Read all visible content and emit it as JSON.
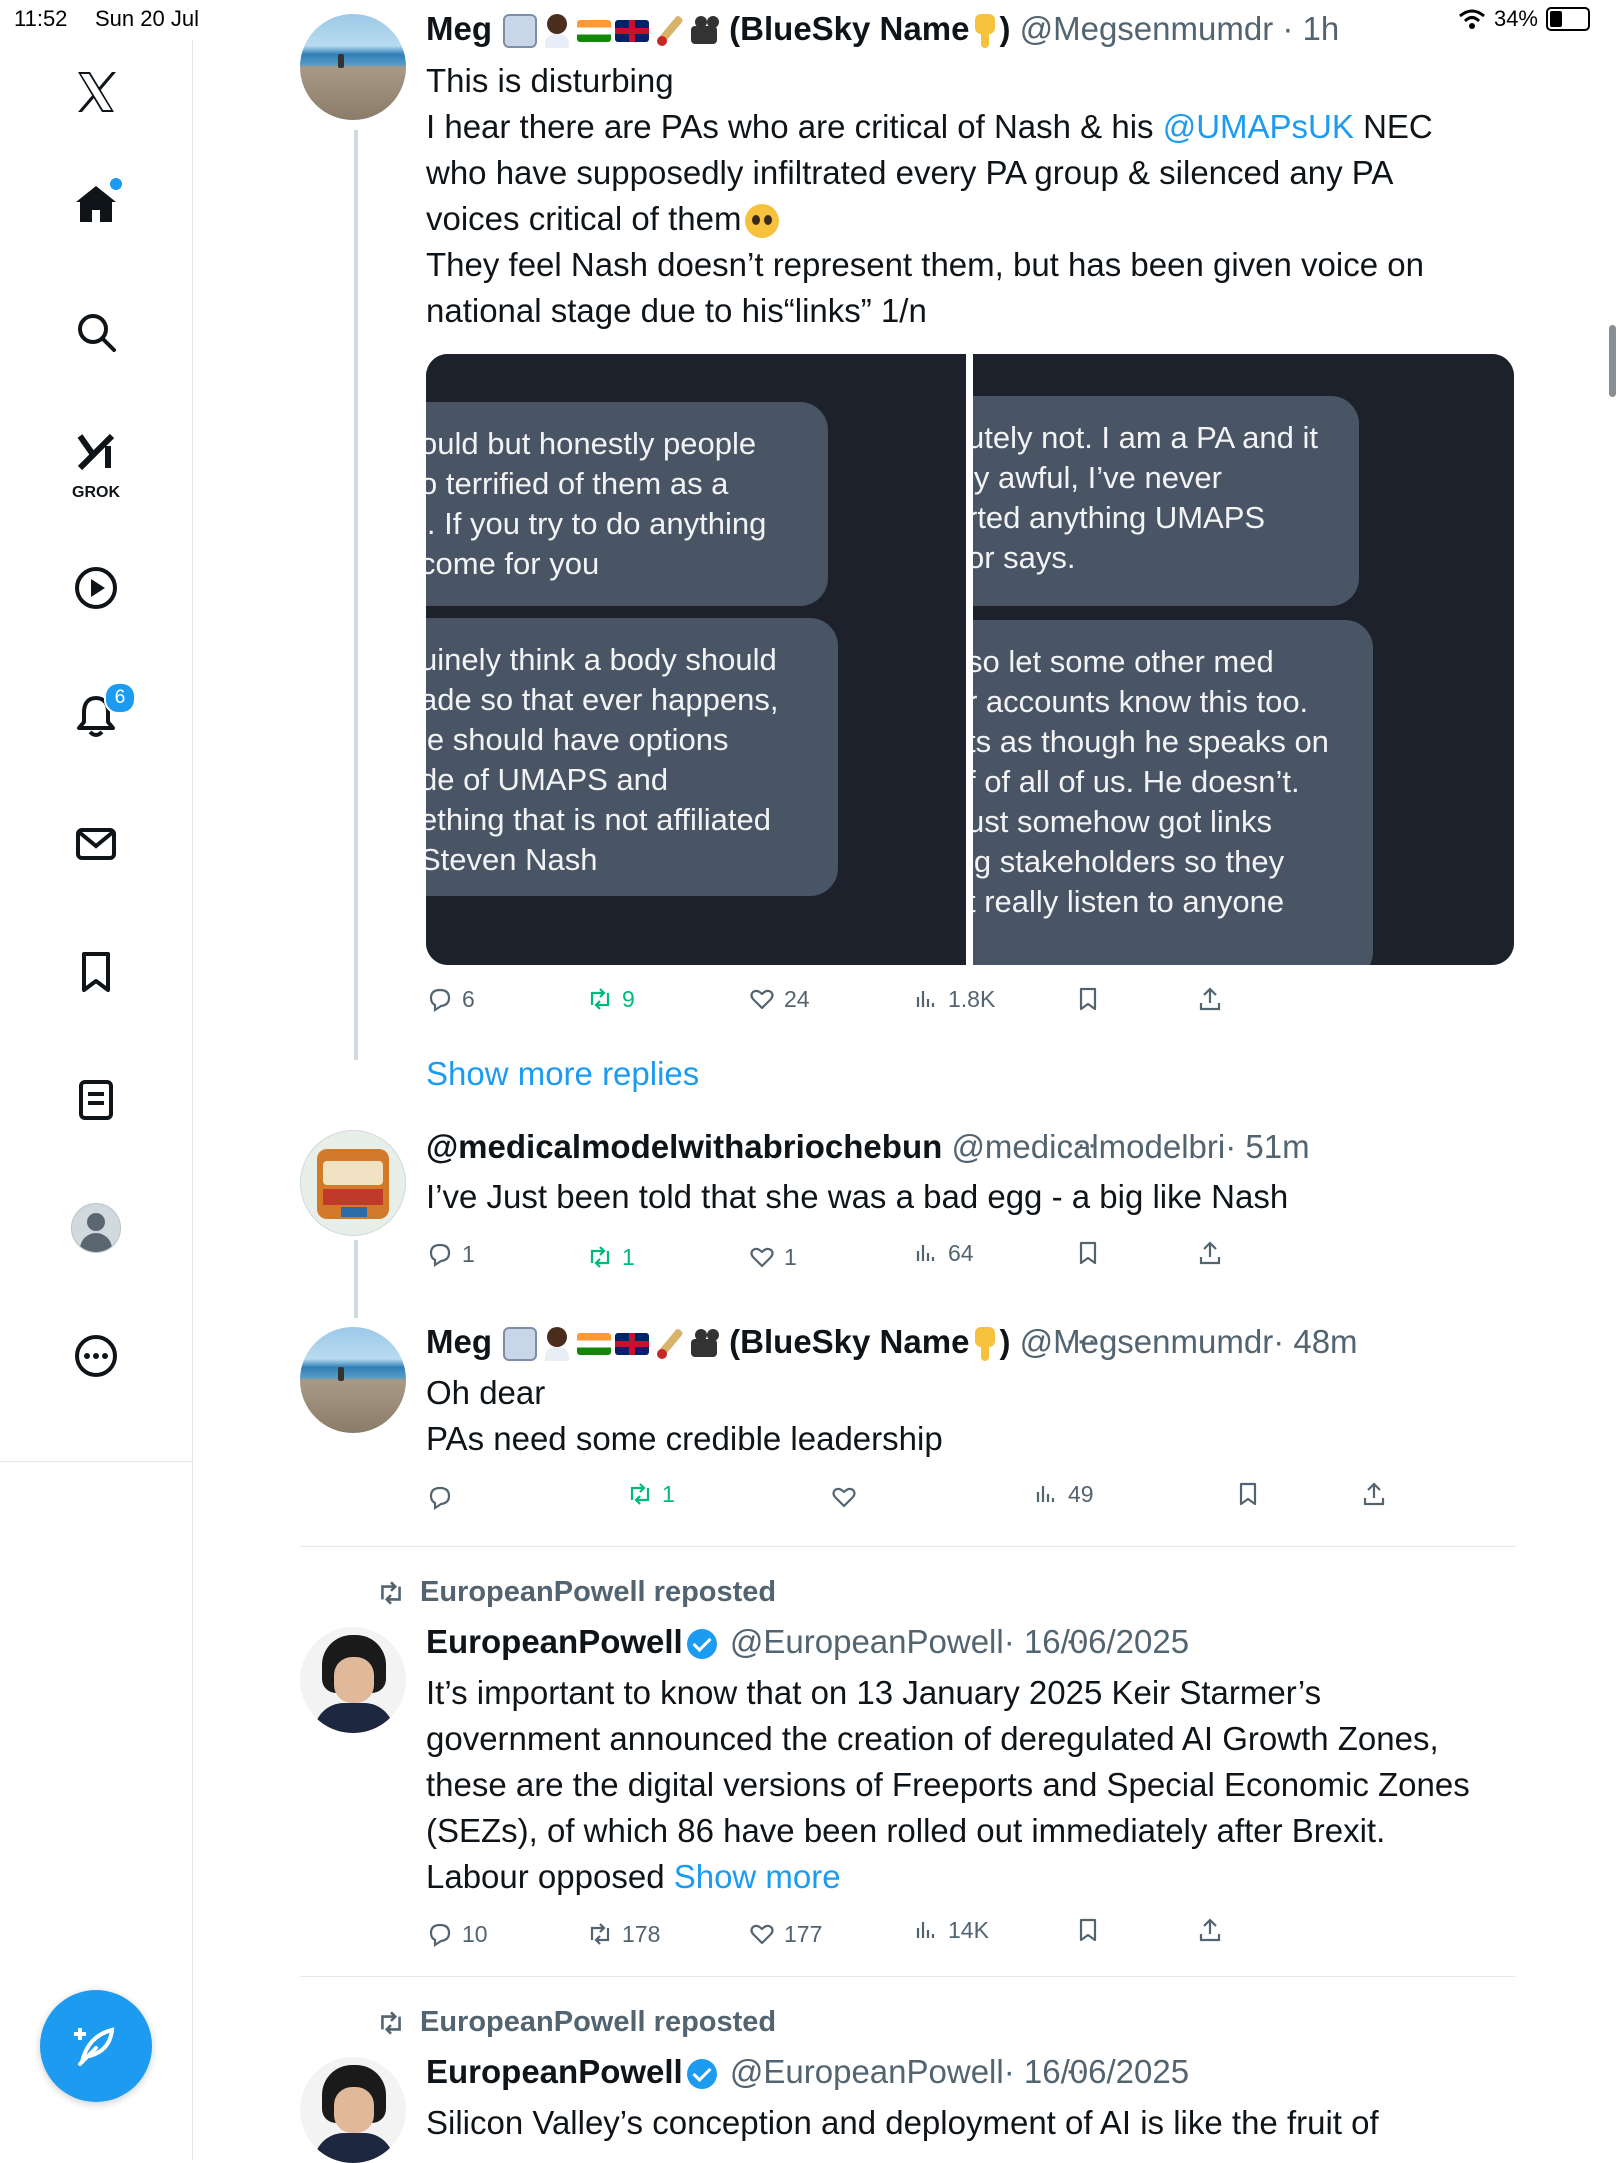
{
  "status": {
    "time": "11:52",
    "date": "Sun 20 Jul",
    "battery": "34%"
  },
  "sidebar": {
    "items": [
      {
        "name": "x-logo"
      },
      {
        "name": "home"
      },
      {
        "name": "search"
      },
      {
        "name": "grok",
        "label": "GROK"
      },
      {
        "name": "videos"
      },
      {
        "name": "notifications",
        "badge": "6"
      },
      {
        "name": "messages"
      },
      {
        "name": "bookmarks"
      },
      {
        "name": "lists"
      },
      {
        "name": "profile"
      },
      {
        "name": "more"
      }
    ]
  },
  "tweets": [
    {
      "name": "Meg",
      "display_suffix": "(BlueSky Name",
      "display_close": ")",
      "handle": "@Megsenmumdr",
      "time": "· 1h",
      "lines": [
        "This is disturbing",
        "I hear there are PAs who are critical of Nash & his ",
        " NEC",
        "who have supposedly infiltrated every PA group & silenced any PA",
        "voices critical of them",
        "They feel Nash doesn’t represent them, but has been given voice on",
        "national stage due to his“links” 1/n"
      ],
      "mention": "@UMAPsUK",
      "media": {
        "left_bubbles": [
          "ould but honestly people\no terrified of them as a\n’. If you try to do anything\ncome for you",
          "uinely think a body should\nade so that ever happens,\nle should have options\nde of UMAPS and\nething that is not affiliated\nSteven Nash"
        ],
        "right_bubbles": [
          "utely not. I am a PA and it\nly awful, I’ve never\nrted anything UMAPS\nor says.",
          "so let some other med\nr accounts know this too.\nts as though he speaks on\nf of all of us. He doesn’t.\nust somehow got links\nig stakeholders so they\nt really listen to anyone"
        ]
      },
      "replies": "6",
      "reposts": "9",
      "likes": "24",
      "views": "1.8K"
    },
    {
      "name": "@medicalmodelwithabriochebun",
      "handle": "@medicalmodelbri",
      "time": "· 51m",
      "text": "I’ve Just been told  that she was a bad egg - a big like Nash",
      "replies": "1",
      "reposts": "1",
      "likes": "1",
      "views": "64"
    },
    {
      "name": "Meg",
      "display_suffix": "(BlueSky Name",
      "display_close": ")",
      "handle": "@Megsenmumdr",
      "time": "· 48m",
      "lines": [
        "Oh dear",
        "PAs need some credible leadership"
      ],
      "replies": "",
      "reposts": "1",
      "likes": "",
      "views": "49"
    },
    {
      "repost_label": "EuropeanPowell reposted",
      "name": "EuropeanPowell",
      "handle": "@EuropeanPowell",
      "time": "· 16/06/2025",
      "lines": [
        "It’s important to know that on 13 January 2025 Keir Starmer’s",
        "government announced the creation of deregulated AI Growth Zones,",
        "these are the digital versions of Freeports and Special Economic Zones",
        "(SEZs), of which 86 have been rolled out immediately after Brexit.",
        "Labour opposed "
      ],
      "show_more": "Show more",
      "replies": "10",
      "reposts": "178",
      "likes": "177",
      "views": "14K"
    },
    {
      "repost_label": "EuropeanPowell reposted",
      "name": "EuropeanPowell",
      "handle": "@EuropeanPowell",
      "time": "· 16/06/2025",
      "lines": [
        "Silicon Valley’s conception and deployment of AI is like the fruit of"
      ]
    }
  ],
  "show_more_replies": "Show more replies",
  "more_dots": "···",
  "colors": {
    "accent": "#1d9bf0",
    "repost": "#00ba7c",
    "muted": "#536471"
  }
}
